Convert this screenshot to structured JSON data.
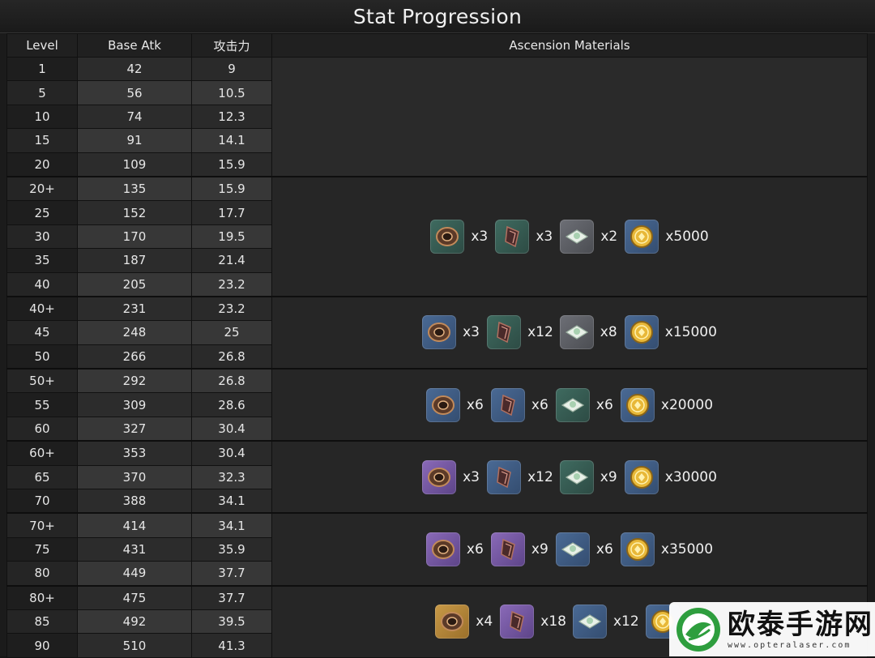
{
  "title": "Stat Progression",
  "headers": {
    "level": "Level",
    "base_atk": "Base Atk",
    "substat": "攻击力",
    "materials": "Ascension Materials"
  },
  "rows": [
    {
      "level": "1",
      "atk": "42",
      "sub": "9"
    },
    {
      "level": "5",
      "atk": "56",
      "sub": "10.5"
    },
    {
      "level": "10",
      "atk": "74",
      "sub": "12.3"
    },
    {
      "level": "15",
      "atk": "91",
      "sub": "14.1"
    },
    {
      "level": "20",
      "atk": "109",
      "sub": "15.9"
    },
    {
      "level": "20+",
      "atk": "135",
      "sub": "15.9"
    },
    {
      "level": "25",
      "atk": "152",
      "sub": "17.7"
    },
    {
      "level": "30",
      "atk": "170",
      "sub": "19.5"
    },
    {
      "level": "35",
      "atk": "187",
      "sub": "21.4"
    },
    {
      "level": "40",
      "atk": "205",
      "sub": "23.2"
    },
    {
      "level": "40+",
      "atk": "231",
      "sub": "23.2"
    },
    {
      "level": "45",
      "atk": "248",
      "sub": "25"
    },
    {
      "level": "50",
      "atk": "266",
      "sub": "26.8"
    },
    {
      "level": "50+",
      "atk": "292",
      "sub": "26.8"
    },
    {
      "level": "55",
      "atk": "309",
      "sub": "28.6"
    },
    {
      "level": "60",
      "atk": "327",
      "sub": "30.4"
    },
    {
      "level": "60+",
      "atk": "353",
      "sub": "30.4"
    },
    {
      "level": "65",
      "atk": "370",
      "sub": "32.3"
    },
    {
      "level": "70",
      "atk": "388",
      "sub": "34.1"
    },
    {
      "level": "70+",
      "atk": "414",
      "sub": "34.1"
    },
    {
      "level": "75",
      "atk": "431",
      "sub": "35.9"
    },
    {
      "level": "80",
      "atk": "449",
      "sub": "37.7"
    },
    {
      "level": "80+",
      "atk": "475",
      "sub": "37.7"
    },
    {
      "level": "85",
      "atk": "492",
      "sub": "39.5"
    },
    {
      "level": "90",
      "atk": "510",
      "sub": "41.3"
    }
  ],
  "material_groups": [
    {
      "items": []
    },
    {
      "items": [
        {
          "icon": "weapon-domain-material-icon",
          "bg": "green",
          "qty": "x3"
        },
        {
          "icon": "elite-drop-material-icon",
          "bg": "green",
          "qty": "x3"
        },
        {
          "icon": "common-drop-material-icon",
          "bg": "gray",
          "qty": "x2"
        },
        {
          "icon": "mora-coin-icon",
          "bg": "blue",
          "qty": "x5000"
        }
      ]
    },
    {
      "items": [
        {
          "icon": "weapon-domain-material-icon",
          "bg": "blue",
          "qty": "x3"
        },
        {
          "icon": "elite-drop-material-icon",
          "bg": "green",
          "qty": "x12"
        },
        {
          "icon": "common-drop-material-icon",
          "bg": "gray",
          "qty": "x8"
        },
        {
          "icon": "mora-coin-icon",
          "bg": "blue",
          "qty": "x15000"
        }
      ]
    },
    {
      "items": [
        {
          "icon": "weapon-domain-material-icon",
          "bg": "blue",
          "qty": "x6"
        },
        {
          "icon": "elite-drop-material-icon",
          "bg": "blue",
          "qty": "x6"
        },
        {
          "icon": "common-drop-material-icon",
          "bg": "green",
          "qty": "x6"
        },
        {
          "icon": "mora-coin-icon",
          "bg": "blue",
          "qty": "x20000"
        }
      ]
    },
    {
      "items": [
        {
          "icon": "weapon-domain-material-icon",
          "bg": "purple",
          "qty": "x3"
        },
        {
          "icon": "elite-drop-material-icon",
          "bg": "blue",
          "qty": "x12"
        },
        {
          "icon": "common-drop-material-icon",
          "bg": "green",
          "qty": "x9"
        },
        {
          "icon": "mora-coin-icon",
          "bg": "blue",
          "qty": "x30000"
        }
      ]
    },
    {
      "items": [
        {
          "icon": "weapon-domain-material-icon",
          "bg": "purple",
          "qty": "x6"
        },
        {
          "icon": "elite-drop-material-icon",
          "bg": "purple",
          "qty": "x9"
        },
        {
          "icon": "common-drop-material-icon",
          "bg": "blue",
          "qty": "x6"
        },
        {
          "icon": "mora-coin-icon",
          "bg": "blue",
          "qty": "x35000"
        }
      ]
    },
    {
      "items": [
        {
          "icon": "weapon-domain-material-icon",
          "bg": "gold",
          "qty": "x4"
        },
        {
          "icon": "elite-drop-material-icon",
          "bg": "purple",
          "qty": "x18"
        },
        {
          "icon": "common-drop-material-icon",
          "bg": "blue",
          "qty": "x12"
        },
        {
          "icon": "mora-coin-icon",
          "bg": "blue",
          "qty": ""
        }
      ]
    }
  ],
  "group_sizes": [
    5,
    5,
    3,
    3,
    3,
    3,
    3
  ],
  "watermark": {
    "title": "欧泰手游网",
    "url": "www.opteralaser.com"
  }
}
